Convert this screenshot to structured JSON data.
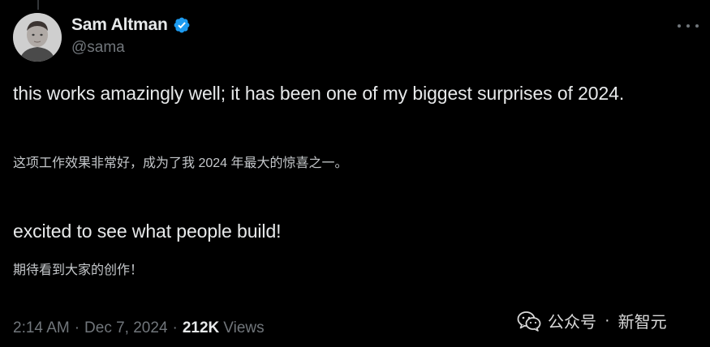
{
  "tweet": {
    "display_name": "Sam Altman",
    "handle": "@sama",
    "paragraph_1": "this works amazingly well; it has been one of my biggest surprises of 2024.",
    "translation_1": "这项工作效果非常好，成为了我 2024 年最大的惊喜之一。",
    "paragraph_2": "excited to see what people build!",
    "translation_2": "期待看到大家的创作！",
    "time": "2:14 AM",
    "date": "Dec 7, 2024",
    "views_count": "212K",
    "views_label": "Views"
  },
  "icons": {
    "verified": "verified-badge-icon",
    "more": "more-options-icon",
    "wechat": "wechat-icon"
  },
  "watermark": {
    "label": "公众号",
    "separator": "·",
    "name": "新智元"
  },
  "colors": {
    "background": "#000000",
    "text_primary": "#e7e9ea",
    "text_secondary": "#71767b",
    "verified_blue": "#1d9bf0"
  }
}
